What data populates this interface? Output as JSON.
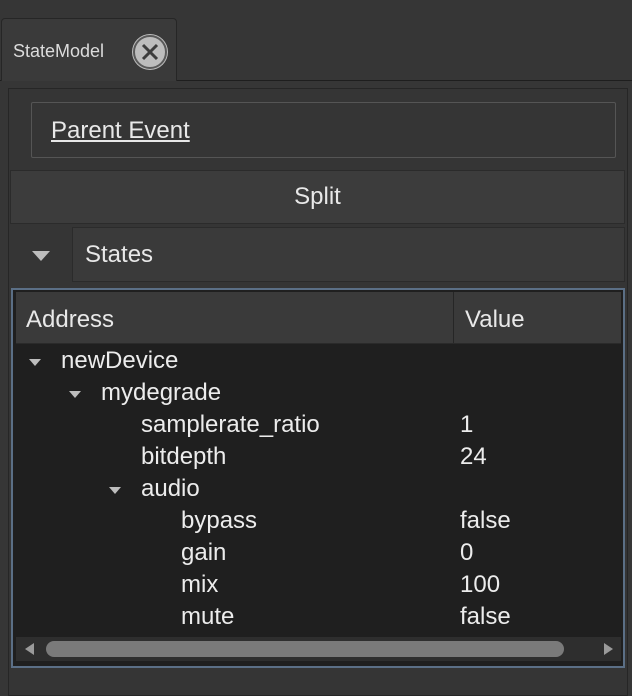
{
  "tab": {
    "label": "StateModel"
  },
  "parent_event": {
    "label": "Parent Event"
  },
  "split": {
    "label": "Split"
  },
  "states": {
    "label": "States"
  },
  "table": {
    "headers": {
      "address": "Address",
      "value": "Value"
    },
    "rows": [
      {
        "name": "newDevice",
        "value": "",
        "level": 0,
        "expanded": true
      },
      {
        "name": "mydegrade",
        "value": "",
        "level": 1,
        "expanded": true
      },
      {
        "name": "samplerate_ratio",
        "value": "1",
        "level": 2
      },
      {
        "name": "bitdepth",
        "value": "24",
        "level": 2
      },
      {
        "name": "audio",
        "value": "",
        "level": 2,
        "expanded": true
      },
      {
        "name": "bypass",
        "value": "false",
        "level": 3
      },
      {
        "name": "gain",
        "value": "0",
        "level": 3
      },
      {
        "name": "mix",
        "value": "100",
        "level": 3
      },
      {
        "name": "mute",
        "value": "false",
        "level": 3
      }
    ]
  },
  "colors": {
    "background": "#363636",
    "tree_background": "#1f1f1f",
    "selection_border": "#5b6f86"
  }
}
